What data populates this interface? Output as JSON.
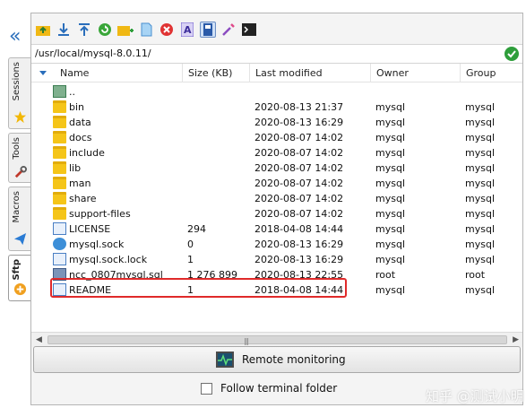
{
  "sidebar": {
    "tabs": [
      {
        "label": "Sessions",
        "icon": "star-icon"
      },
      {
        "label": "Tools",
        "icon": "tools-icon"
      },
      {
        "label": "Macros",
        "icon": "paper-plane-icon"
      },
      {
        "label": "Sftp",
        "icon": "sftp-icon",
        "active": true
      }
    ]
  },
  "toolbar": {
    "buttons": [
      "upload-folder-icon",
      "download-icon",
      "upload-icon",
      "refresh-icon",
      "new-folder-icon",
      "new-file-icon",
      "delete-icon",
      "text-icon",
      "toggle-hidden-icon",
      "edit-icon",
      "terminal-icon"
    ]
  },
  "path": "/usr/local/mysql-8.0.11/",
  "columns": {
    "name": "Name",
    "size": "Size (KB)",
    "modified": "Last modified",
    "owner": "Owner",
    "group": "Group"
  },
  "files": [
    {
      "name": "..",
      "size": "",
      "modified": "",
      "owner": "",
      "group": "",
      "kind": "parent"
    },
    {
      "name": "bin",
      "size": "",
      "modified": "2020-08-13 21:37",
      "owner": "mysql",
      "group": "mysql",
      "kind": "folder"
    },
    {
      "name": "data",
      "size": "",
      "modified": "2020-08-13 16:29",
      "owner": "mysql",
      "group": "mysql",
      "kind": "folder"
    },
    {
      "name": "docs",
      "size": "",
      "modified": "2020-08-07 14:02",
      "owner": "mysql",
      "group": "mysql",
      "kind": "folder"
    },
    {
      "name": "include",
      "size": "",
      "modified": "2020-08-07 14:02",
      "owner": "mysql",
      "group": "mysql",
      "kind": "folder"
    },
    {
      "name": "lib",
      "size": "",
      "modified": "2020-08-07 14:02",
      "owner": "mysql",
      "group": "mysql",
      "kind": "folder"
    },
    {
      "name": "man",
      "size": "",
      "modified": "2020-08-07 14:02",
      "owner": "mysql",
      "group": "mysql",
      "kind": "folder"
    },
    {
      "name": "share",
      "size": "",
      "modified": "2020-08-07 14:02",
      "owner": "mysql",
      "group": "mysql",
      "kind": "folder"
    },
    {
      "name": "support-files",
      "size": "",
      "modified": "2020-08-07 14:02",
      "owner": "mysql",
      "group": "mysql",
      "kind": "folder"
    },
    {
      "name": "LICENSE",
      "size": "294",
      "modified": "2018-04-08 14:44",
      "owner": "mysql",
      "group": "mysql",
      "kind": "doc"
    },
    {
      "name": "mysql.sock",
      "size": "0",
      "modified": "2020-08-13 16:29",
      "owner": "mysql",
      "group": "mysql",
      "kind": "sock"
    },
    {
      "name": "mysql.sock.lock",
      "size": "1",
      "modified": "2020-08-13 16:29",
      "owner": "mysql",
      "group": "mysql",
      "kind": "doc"
    },
    {
      "name": "ncc_0807mysql.sql",
      "size": "1 276 899",
      "modified": "2020-08-13 22:55",
      "owner": "root",
      "group": "root",
      "kind": "sql"
    },
    {
      "name": "README",
      "size": "1",
      "modified": "2018-04-08 14:44",
      "owner": "mysql",
      "group": "mysql",
      "kind": "doc"
    }
  ],
  "monitor_label": "Remote monitoring",
  "follow_label": "Follow terminal folder",
  "watermark": "知乎 @测试小明"
}
